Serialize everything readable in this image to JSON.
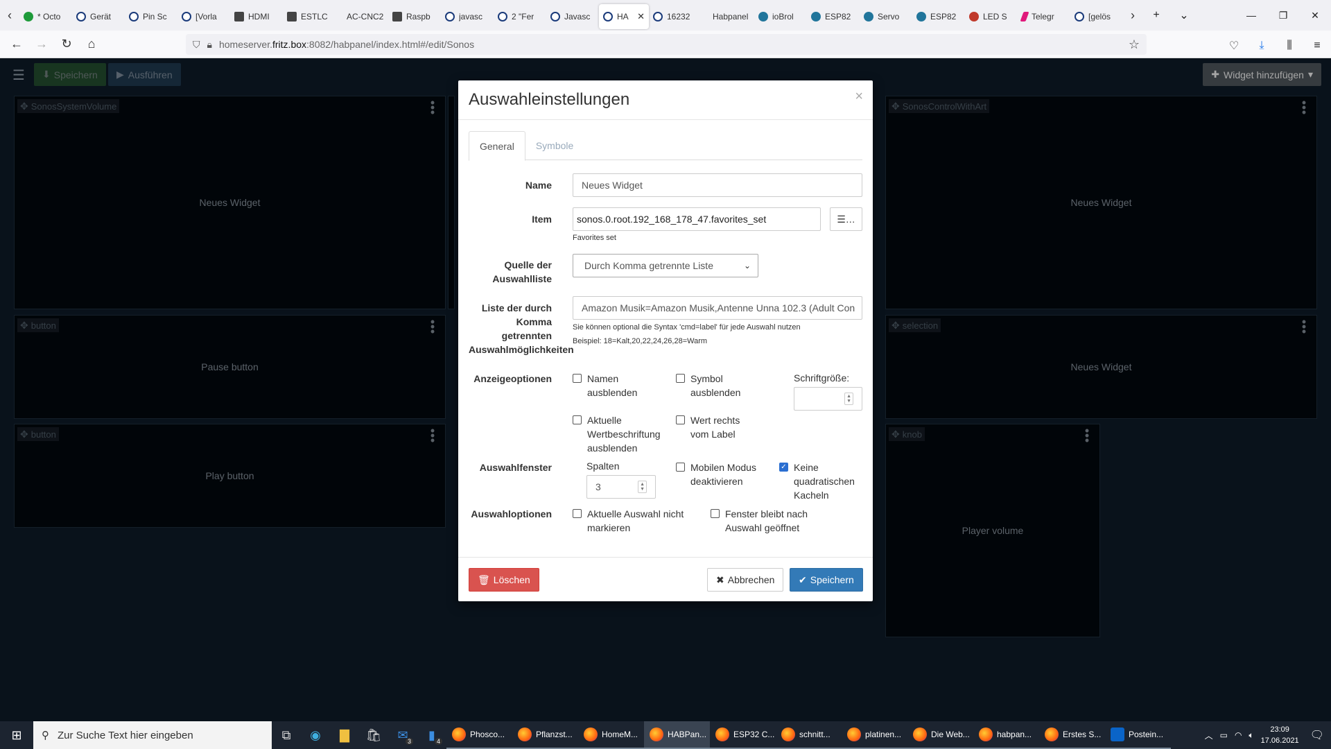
{
  "browser": {
    "tabs": [
      {
        "title": "* Octo",
        "icon": "octoprint-icon",
        "favclass": "green"
      },
      {
        "title": "Gerät",
        "icon": "iobroker-icon",
        "favclass": ""
      },
      {
        "title": "Pin Sc",
        "icon": "iobroker-icon",
        "favclass": ""
      },
      {
        "title": "[Vorla",
        "icon": "iobroker-icon",
        "favclass": ""
      },
      {
        "title": "HDMI",
        "icon": "document-icon",
        "favclass": "sq"
      },
      {
        "title": "ESTLC",
        "icon": "tool-icon",
        "favclass": "sq"
      },
      {
        "title": "AC-CNC2",
        "icon": "blank-icon",
        "favclass": "plain"
      },
      {
        "title": "Raspb",
        "icon": "raspberry-icon",
        "favclass": "sq"
      },
      {
        "title": "javasc",
        "icon": "iobroker-icon",
        "favclass": ""
      },
      {
        "title": "2 \"Fer",
        "icon": "iobroker-icon",
        "favclass": ""
      },
      {
        "title": "Javasc",
        "icon": "iobroker-icon",
        "favclass": ""
      }
    ],
    "active_tab": {
      "title": "HA",
      "icon": "habpanel-icon"
    },
    "tabs_after": [
      {
        "title": "16232",
        "icon": "iobroker-icon",
        "favclass": ""
      },
      {
        "title": "Habpanel",
        "icon": "blank-icon",
        "favclass": "plain"
      },
      {
        "title": "ioBrol",
        "icon": "wordpress-icon",
        "favclass": "wp"
      },
      {
        "title": "ESP82",
        "icon": "wordpress-icon",
        "favclass": "wp"
      },
      {
        "title": "Servo",
        "icon": "wordpress-icon",
        "favclass": "wp"
      },
      {
        "title": "ESP82",
        "icon": "wordpress-icon",
        "favclass": "wp"
      },
      {
        "title": "LED S",
        "icon": "led-icon",
        "favclass": "red"
      },
      {
        "title": "Telegr",
        "icon": "telegram-icon",
        "favclass": "pink"
      },
      {
        "title": "[gelös",
        "icon": "iobroker-icon",
        "favclass": ""
      }
    ],
    "url_prefix": "homeserver.",
    "url_domain": "fritz.box",
    "url_rest": ":8082/habpanel/index.html#/edit/Sonos"
  },
  "toolbar": {
    "save_label": "Speichern",
    "run_label": "Ausführen",
    "add_widget_label": "Widget hinzufügen"
  },
  "widgets": [
    {
      "tag": "SonosSystemVolume",
      "label": "Neues Widget"
    },
    {
      "tag": "SonosControlWithArt",
      "label": "Neues Widget"
    },
    {
      "tag": "button",
      "label": "Pause button"
    },
    {
      "tag": "selection",
      "label": "Neues Widget"
    },
    {
      "tag": "button",
      "label": "Play button"
    },
    {
      "tag": "knob",
      "label": "Player volume"
    }
  ],
  "modal": {
    "title": "Auswahleinstellungen",
    "close": "×",
    "tabs": {
      "general": "General",
      "symbols": "Symbole"
    },
    "name_label": "Name",
    "name_value": "Neues Widget",
    "item_label": "Item",
    "item_value": "sonos.0.root.192_168_178_47.favorites_set",
    "item_help": "Favorites set",
    "source_label_1": "Quelle der",
    "source_label_2": "Auswahlliste",
    "source_value": "Durch Komma getrennte Liste",
    "list_label_1": "Liste der durch",
    "list_label_2": "Komma",
    "list_label_3": "getrennten",
    "list_label_4": "Auswahlmöglichkeiten",
    "list_value": "Amazon Musik=Amazon Musik,Antenne Unna 102.3 (Adult Con",
    "list_help_1": "Sie können optional die Syntax 'cmd=label' für jede Auswahl nutzen",
    "list_help_2": "Beispiel: 18=Kalt,20,22,24,26,28=Warm",
    "display_label": "Anzeigeoptionen",
    "hide_name_1": "Namen",
    "hide_name_2": "ausblenden",
    "hide_symbol_1": "Symbol",
    "hide_symbol_2": "ausblenden",
    "font_size_label": "Schriftgröße:",
    "hide_value_1": "Aktuelle",
    "hide_value_2": "Wertbeschriftung",
    "hide_value_3": "ausblenden",
    "value_right_1": "Wert rechts",
    "value_right_2": "vom Label",
    "window_label": "Auswahlfenster",
    "columns_label": "Spalten",
    "columns_value": "3",
    "mobile_1": "Mobilen Modus",
    "mobile_2": "deaktivieren",
    "square_1": "Keine",
    "square_2": "quadratischen",
    "square_3": "Kacheln",
    "options_label": "Auswahloptionen",
    "nomark_1": "Aktuelle Auswahl nicht",
    "nomark_2": "markieren",
    "keepopen_1": "Fenster bleibt nach",
    "keepopen_2": "Auswahl geöffnet",
    "delete_label": "Löschen",
    "cancel_label": "Abbrechen",
    "save_label": "Speichern",
    "checks": {
      "hide_name": false,
      "hide_symbol": false,
      "hide_value": false,
      "value_right": false,
      "mobile": false,
      "square": true,
      "nomark": false,
      "keepopen": false
    }
  },
  "taskbar": {
    "search_placeholder": "Zur Suche Text hier eingeben",
    "mail_badge": "3",
    "phone_badge": "4",
    "tasks": [
      {
        "title": "Phosco...",
        "type": "ff"
      },
      {
        "title": "Pflanzst...",
        "type": "ff"
      },
      {
        "title": "HomeM...",
        "type": "ff"
      },
      {
        "title": "HABPan...",
        "type": "ff",
        "active": true
      },
      {
        "title": "ESP32 C...",
        "type": "ff"
      },
      {
        "title": "schnitt...",
        "type": "ff"
      },
      {
        "title": "platinen...",
        "type": "ff"
      },
      {
        "title": "Die Web...",
        "type": "ff"
      },
      {
        "title": "habpan...",
        "type": "ff"
      },
      {
        "title": "Erstes S...",
        "type": "ff"
      },
      {
        "title": "Postein...",
        "type": "ol"
      }
    ],
    "time": "23:09",
    "date": "17.06.2021"
  },
  "colors": {
    "accent": "#337ab7",
    "danger": "#d9534f",
    "app_bg": "#0e1c2a",
    "widget_bg": "#03090f"
  }
}
